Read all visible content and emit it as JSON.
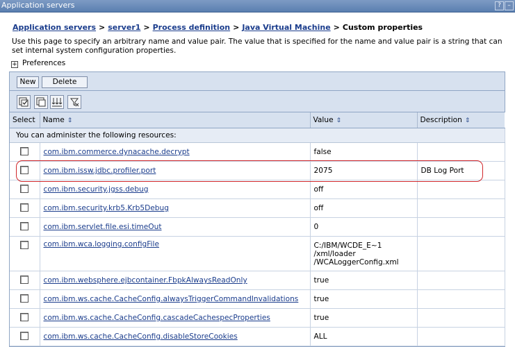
{
  "window": {
    "title": "Application servers",
    "help_label": "?",
    "minimize_label": "–"
  },
  "breadcrumb": {
    "links": [
      "Application servers",
      "server1",
      "Process definition",
      "Java Virtual Machine"
    ],
    "separator": ">",
    "current": "Custom properties"
  },
  "description": "Use this page to specify an arbitrary name and value pair. The value that is specified for the name and value pair is a string that can set internal system configuration properties.",
  "preferences": {
    "label": "Preferences",
    "toggle": "+"
  },
  "toolbar": {
    "new_label": "New",
    "delete_label": "Delete"
  },
  "icon_toolbar": [
    "select-all-icon",
    "deselect-all-icon",
    "filter-icon",
    "clear-filter-icon"
  ],
  "table": {
    "headers": {
      "select": "Select",
      "name": "Name",
      "value": "Value",
      "description": "Description"
    },
    "sort_glyph": "⇕",
    "admin_text": "You can administer the following resources:",
    "rows": [
      {
        "name": "com.ibm.commerce.dynacache.decrypt",
        "value": "false",
        "description": ""
      },
      {
        "name": "com.ibm.issw.jdbc.profiler.port",
        "value": "2075",
        "description": "DB Log Port"
      },
      {
        "name": "com.ibm.security.jgss.debug",
        "value": "off",
        "description": ""
      },
      {
        "name": "com.ibm.security.krb5.Krb5Debug",
        "value": "off",
        "description": ""
      },
      {
        "name": "com.ibm.servlet.file.esi.timeOut",
        "value": "0",
        "description": ""
      },
      {
        "name": "com.ibm.wca.logging.configFile",
        "value_lines": [
          "C:/IBM/WCDE_E~1",
          "/xml/loader",
          "/WCALoggerConfig.xml"
        ],
        "description": ""
      },
      {
        "name": "com.ibm.websphere.ejbcontainer.FbpkAlwaysReadOnly",
        "value": "true",
        "description": ""
      },
      {
        "name": "com.ibm.ws.cache.CacheConfig.alwaysTriggerCommandInvalidations",
        "value": "true",
        "description": ""
      },
      {
        "name": "com.ibm.ws.cache.CacheConfig.cascadeCachespecProperties",
        "value": "true",
        "description": ""
      },
      {
        "name": "com.ibm.ws.cache.CacheConfig.disableStoreCookies",
        "value": "ALL",
        "description": ""
      }
    ]
  },
  "highlight_color": "#d0262a"
}
